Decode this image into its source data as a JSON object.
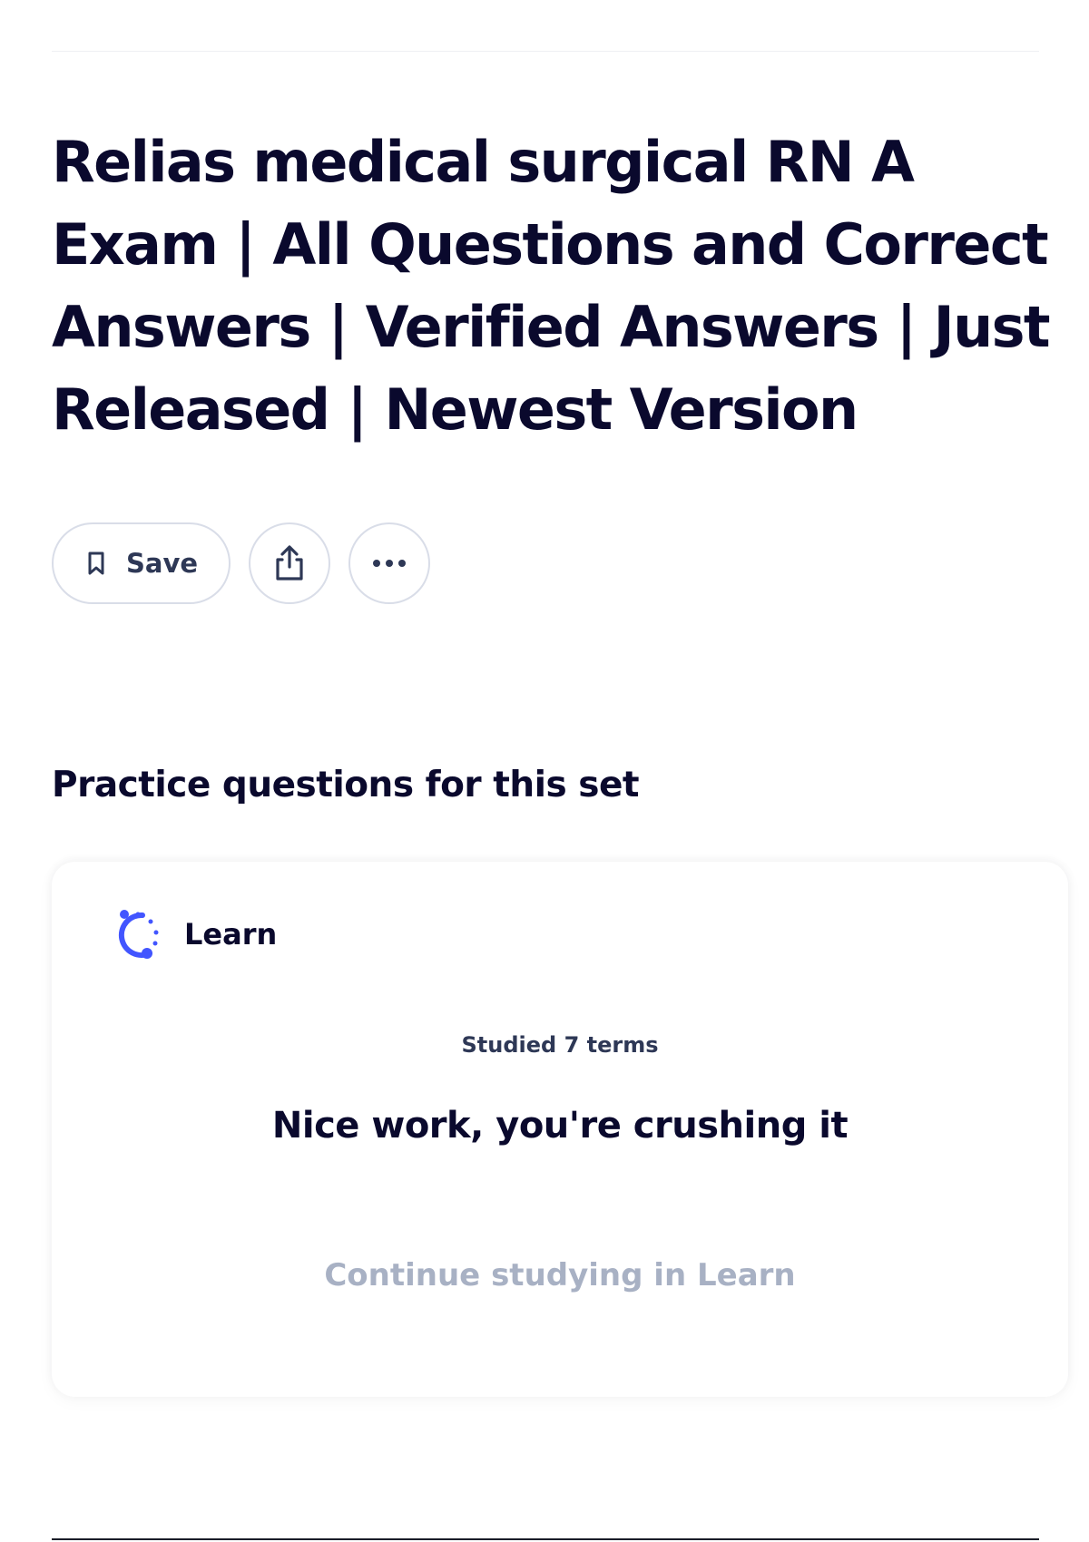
{
  "set": {
    "title": "Relias medical surgical RN A Exam | All Questions and Correct Answers | Verified Answers | Just Released | Newest Version"
  },
  "actions": {
    "save_label": "Save",
    "save_icon": "bookmark-icon",
    "share_icon": "share-icon",
    "more_icon": "more-horizontal-icon"
  },
  "practice": {
    "heading": "Practice questions for this set",
    "card": {
      "mode_label": "Learn",
      "mode_icon": "learn-mode-icon",
      "accent_color": "#4255ff",
      "studied_text": "Studied 7 terms",
      "message": "Nice work, you're crushing it",
      "continue_label": "Continue studying in Learn"
    }
  }
}
